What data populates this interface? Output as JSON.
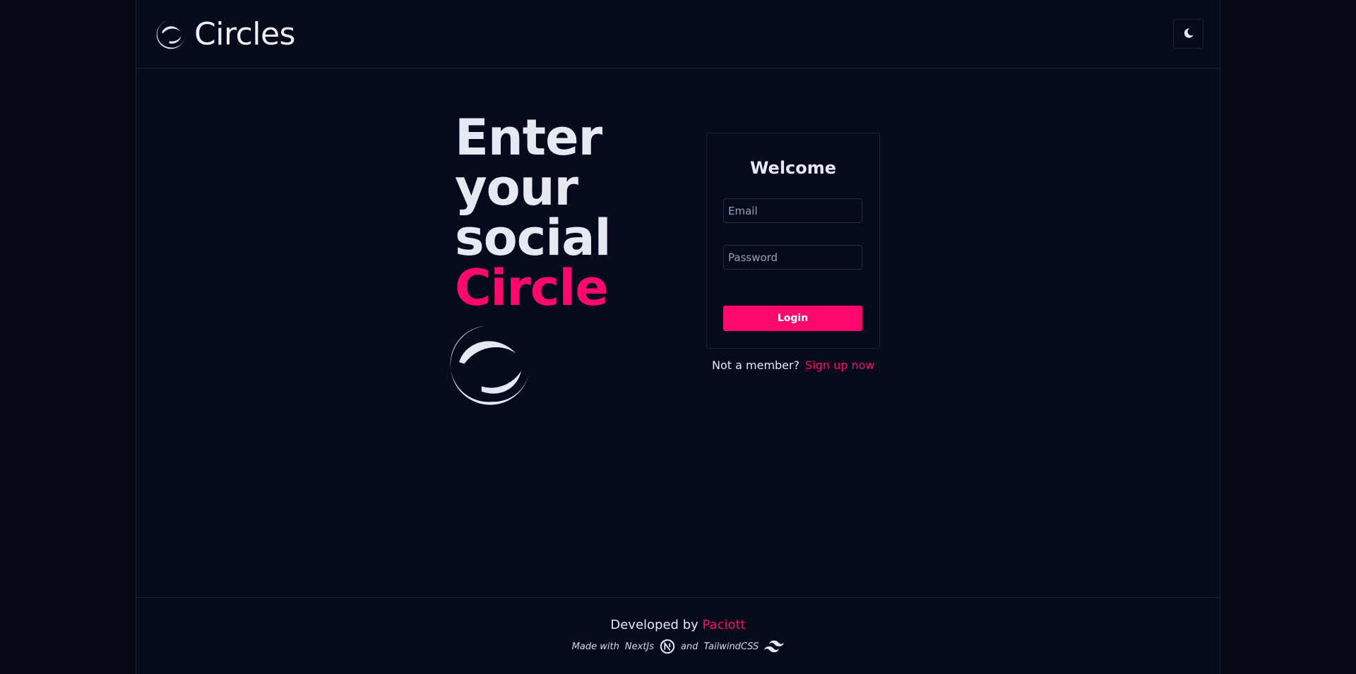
{
  "header": {
    "brand_name": "Circles",
    "theme_toggle_icon": "moon-icon"
  },
  "hero": {
    "line1": "Enter",
    "line2": "your",
    "line3": "social",
    "line4": "Circle"
  },
  "login_card": {
    "title": "Welcome",
    "email_placeholder": "Email",
    "email_value": "",
    "password_placeholder": "Password",
    "password_value": "",
    "login_label": "Login"
  },
  "signup": {
    "prompt": "Not a member?",
    "link_label": "Sign up now"
  },
  "footer": {
    "developed_by": "Developed by",
    "developer": "Paciott",
    "made_with": "Made with",
    "tech1": "NextJs",
    "and": "and",
    "tech2": "TailwindCSS",
    "tech1_icon": "nextjs-icon",
    "tech2_icon": "tailwind-icon"
  },
  "colors": {
    "background": "#050a1d",
    "accent": "#ff0a6c",
    "text": "#e6e9f2",
    "border": "#1f2433"
  }
}
